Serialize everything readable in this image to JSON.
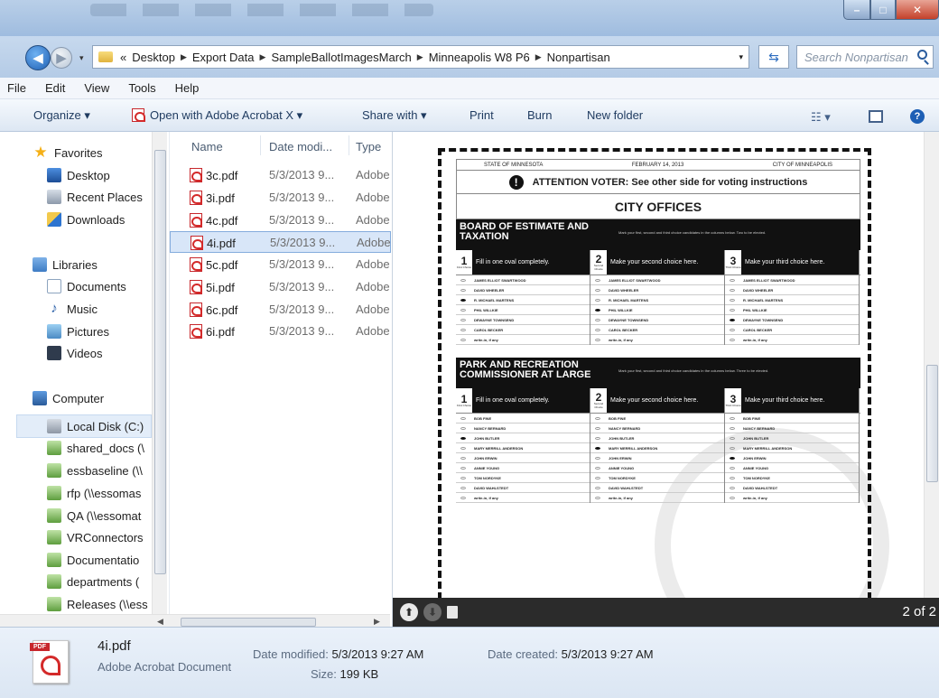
{
  "address": {
    "crumbs": [
      "Desktop",
      "Export Data",
      "SampleBallotImagesMarch",
      "Minneapolis W8 P6",
      "Nonpartisan"
    ],
    "overflow": "«",
    "search_placeholder": "Search Nonpartisan"
  },
  "menu": [
    "File",
    "Edit",
    "View",
    "Tools",
    "Help"
  ],
  "commands": {
    "organize": "Organize ▾",
    "open_with": "Open with Adobe Acrobat X ▾",
    "share": "Share with ▾",
    "print": "Print",
    "burn": "Burn",
    "new_folder": "New folder"
  },
  "nav": {
    "favorites": "Favorites",
    "desktop": "Desktop",
    "recent": "Recent Places",
    "downloads": "Downloads",
    "libraries": "Libraries",
    "documents": "Documents",
    "music": "Music",
    "pictures": "Pictures",
    "videos": "Videos",
    "computer": "Computer",
    "local_disk": "Local Disk (C:)",
    "shared_docs": "shared_docs (\\",
    "essbaseline": "essbaseline (\\\\",
    "rfp": "rfp (\\\\essomas",
    "qa": "QA (\\\\essomat",
    "vrconnectors": "VRConnectors",
    "documentation": "Documentatio",
    "departments": "departments (",
    "releases": "Releases (\\\\ess"
  },
  "files": {
    "col_name": "Name",
    "col_date": "Date modi...",
    "col_type": "Type",
    "rows": [
      {
        "name": "3c.pdf",
        "date": "5/3/2013 9...",
        "type": "Adobe"
      },
      {
        "name": "3i.pdf",
        "date": "5/3/2013 9...",
        "type": "Adobe"
      },
      {
        "name": "4c.pdf",
        "date": "5/3/2013 9...",
        "type": "Adobe"
      },
      {
        "name": "4i.pdf",
        "date": "5/3/2013 9...",
        "type": "Adobe"
      },
      {
        "name": "5c.pdf",
        "date": "5/3/2013 9...",
        "type": "Adobe"
      },
      {
        "name": "5i.pdf",
        "date": "5/3/2013 9...",
        "type": "Adobe"
      },
      {
        "name": "6c.pdf",
        "date": "5/3/2013 9...",
        "type": "Adobe"
      },
      {
        "name": "6i.pdf",
        "date": "5/3/2013 9...",
        "type": "Adobe"
      }
    ]
  },
  "ballot": {
    "state": "STATE OF MINNESOTA",
    "date": "FEBRUARY 14, 2013",
    "city": "CITY OF MINNEAPOLIS",
    "attention": "ATTENTION VOTER: See other side for voting instructions",
    "section": "CITY OFFICES",
    "contest1_title": "BOARD OF ESTIMATE AND TAXATION",
    "contest1_instr": "Mark your first, second and third choice candidates in the columns below. Two to be elected.",
    "contest2_title": "PARK AND RECREATION COMMISSIONER AT LARGE",
    "contest2_instr": "Mark your first, second and third choice candidates in the columns below. Three to be elected.",
    "choice1": "Fill in one oval completely.",
    "choice2": "Make your second choice here.",
    "choice3": "Make your third choice here.",
    "choice1_label": "First Choice",
    "choice2_label": "Second Choice",
    "choice3_label": "Third Choice",
    "contest1_candidates": [
      "JAMES ELLIOT SWARTWOOD",
      "DAVID WHEELER",
      "R. MICHAEL MARTENS",
      "PHIL WILLKIE",
      "DEWAYNE TOWNSEND",
      "CAROL BECKER",
      "write-in, if any"
    ],
    "contest2_candidates": [
      "BOB FINE",
      "NANCY BERNARD",
      "JOHN BUTLER",
      "MARY MERRILL ANDERSON",
      "JOHN ERWIN",
      "ANNIE YOUNG",
      "TOM NORDYKE",
      "DAVID WAHLSTEDT",
      "write-in, if any"
    ]
  },
  "preview": {
    "page": "2 of 2"
  },
  "details": {
    "name": "4i.pdf",
    "type": "Adobe Acrobat Document",
    "date_modified_label": "Date modified:",
    "date_modified": "5/3/2013 9:27 AM",
    "size_label": "Size:",
    "size": "199 KB",
    "date_created_label": "Date created:",
    "date_created": "5/3/2013 9:27 AM",
    "pdf_tag": "PDF"
  }
}
